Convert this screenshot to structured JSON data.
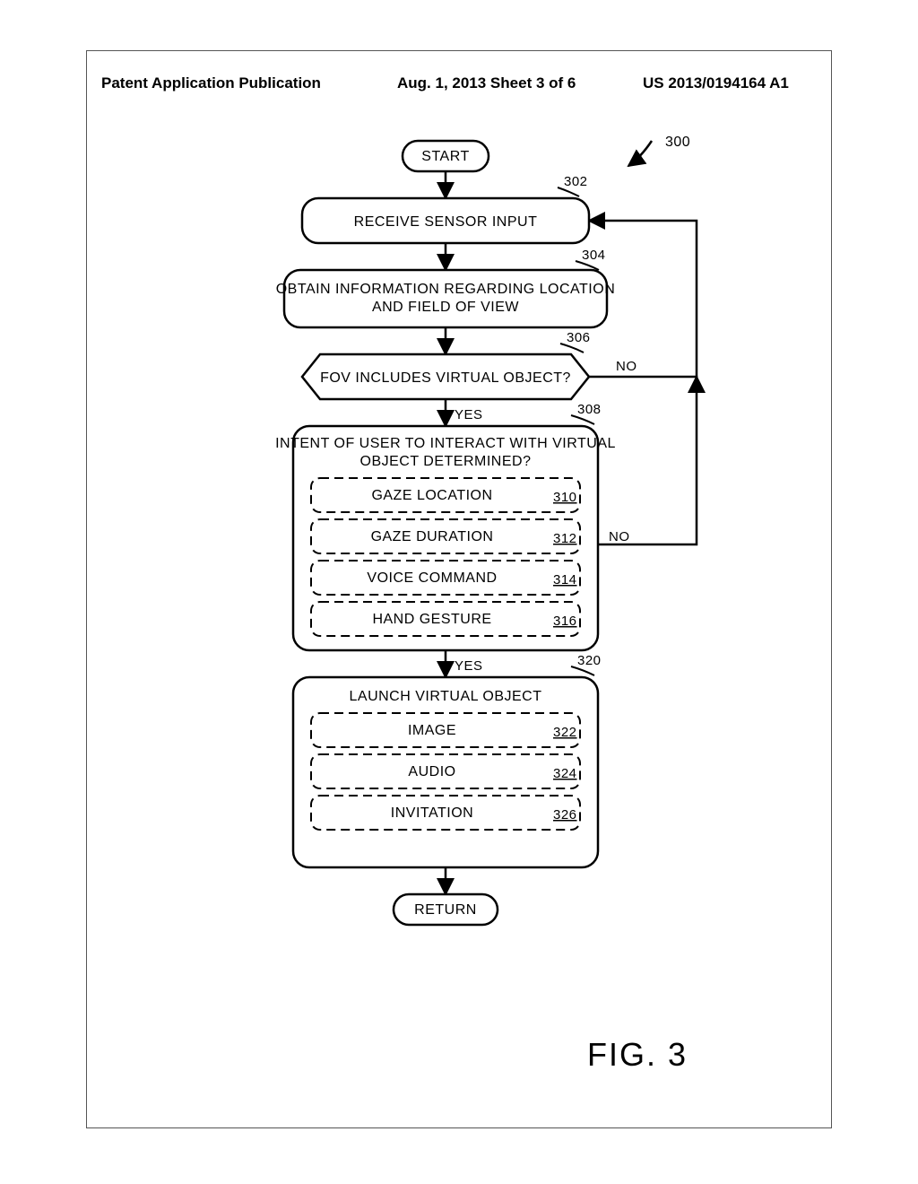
{
  "header": {
    "left": "Patent Application Publication",
    "mid": "Aug. 1, 2013  Sheet 3 of 6",
    "right": "US 2013/0194164 A1"
  },
  "figure_label": "FIG. 3",
  "main_ref": "300",
  "nodes": {
    "start": "START",
    "return": "RETURN",
    "n302": {
      "text": "RECEIVE SENSOR INPUT",
      "ref": "302"
    },
    "n304": {
      "text1": "OBTAIN INFORMATION REGARDING LOCATION",
      "text2": "AND FIELD OF VIEW",
      "ref": "304"
    },
    "n306": {
      "text": "FOV INCLUDES VIRTUAL OBJECT?",
      "ref": "306"
    },
    "n308": {
      "text1": "INTENT OF USER TO INTERACT WITH VIRTUAL",
      "text2": "OBJECT DETERMINED?",
      "ref": "308",
      "sub": [
        {
          "label": "GAZE LOCATION",
          "ref": "310"
        },
        {
          "label": "GAZE DURATION",
          "ref": "312"
        },
        {
          "label": "VOICE COMMAND",
          "ref": "314"
        },
        {
          "label": "HAND GESTURE",
          "ref": "316"
        }
      ]
    },
    "n320": {
      "text": "LAUNCH VIRTUAL OBJECT",
      "ref": "320",
      "sub": [
        {
          "label": "IMAGE",
          "ref": "322"
        },
        {
          "label": "AUDIO",
          "ref": "324"
        },
        {
          "label": "INVITATION",
          "ref": "326"
        }
      ]
    }
  },
  "branches": {
    "yes": "YES",
    "no": "NO"
  }
}
